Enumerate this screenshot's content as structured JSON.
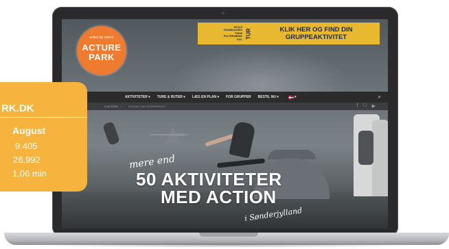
{
  "site": {
    "logo": {
      "tagline": "active by nature",
      "word1": "ACTURE",
      "word2": "PARK"
    },
    "banner": {
      "left_lines": [
        "SKOLE",
        "TEAMBUILDING",
        "FERIE",
        "POLTERABEND",
        "OSV."
      ],
      "vertical_word": "TUR",
      "right_line1": "KLIK HER OG FIND DIN",
      "right_line2": "GRUPPEAKTIVITET"
    },
    "nav": {
      "items": [
        "AKTIVITETER ▾",
        "TURE & RUTER ▾",
        "LÆG EN PLAN ▾",
        "FOR GRUPPER",
        "BESTIL NU ▾"
      ],
      "flag_suffix": "▾",
      "search_icon": "⌕"
    },
    "subbar": {
      "breadcrumb": "S ACTION!  →",
      "note": "FRA DAG I DAG SOMMERHUSE?"
    },
    "social": [
      "f",
      "□",
      "▶"
    ],
    "hero": {
      "script1": "mere end",
      "line1": "50 AKTIVITETER",
      "line2": "MED ACTION",
      "script2": "i Sønderjylland"
    }
  },
  "stats_card": {
    "title": "RK.DK",
    "month": "August",
    "values": [
      "9.405",
      "26.992",
      "1,06 min"
    ]
  },
  "colors": {
    "card_orange": "#f6b33d",
    "logo_orange": "#ee7b2f",
    "banner_yellow": "#e9b831",
    "nav_dark": "#2b2b2b"
  }
}
